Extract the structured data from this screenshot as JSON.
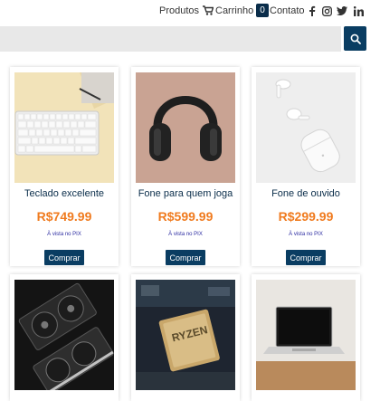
{
  "nav": {
    "products": "Produtos",
    "cart_label": "Carrinho",
    "cart_count": "0",
    "contact": "Contato",
    "social": [
      "facebook-icon",
      "instagram-icon",
      "twitter-icon",
      "linkedin-icon"
    ]
  },
  "search": {
    "placeholder": "",
    "button_icon": "search-icon"
  },
  "products": [
    {
      "title": "Teclado excelente",
      "price": "R$749.99",
      "payment_note": "À vista no PIX",
      "button": "Comprar",
      "image": "keyboard"
    },
    {
      "title": "Fone para quem joga",
      "price": "R$599.99",
      "payment_note": "À vista no PIX",
      "button": "Comprar",
      "image": "headphones"
    },
    {
      "title": "Fone de ouvido",
      "price": "R$299.99",
      "payment_note": "À vista no PIX",
      "button": "Comprar",
      "image": "earbuds"
    },
    {
      "title": "",
      "price": "",
      "payment_note": "",
      "button": "",
      "image": "graphics-card"
    },
    {
      "title": "",
      "price": "",
      "payment_note": "",
      "button": "",
      "image": "cpu"
    },
    {
      "title": "",
      "price": "",
      "payment_note": "",
      "button": "",
      "image": "laptop"
    }
  ],
  "colors": {
    "primary": "#0a3d62",
    "price": "#f07b1f",
    "pix": "#2a2aa0",
    "title": "#0a2d4a"
  }
}
